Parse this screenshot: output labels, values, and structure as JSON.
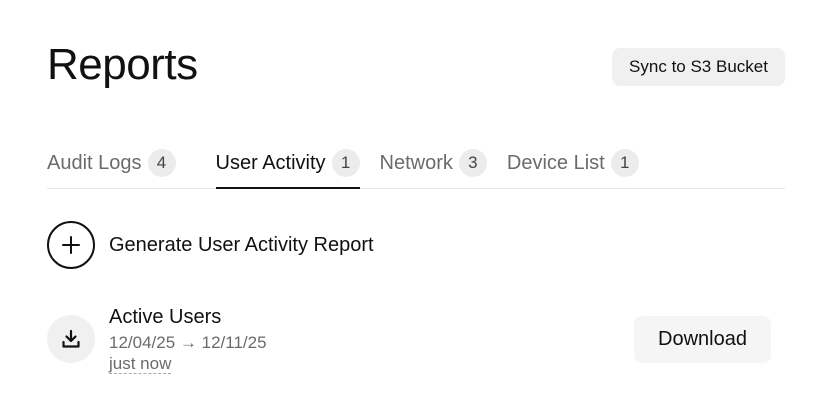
{
  "header": {
    "title": "Reports",
    "sync_button_label": "Sync to S3 Bucket"
  },
  "tabs": [
    {
      "label": "Audit Logs",
      "count": "4",
      "active": false
    },
    {
      "label": "User Activity",
      "count": "1",
      "active": true
    },
    {
      "label": "Network",
      "count": "3",
      "active": false
    },
    {
      "label": "Device List",
      "count": "1",
      "active": false
    }
  ],
  "generate": {
    "icon": "plus-icon",
    "label": "Generate User Activity Report"
  },
  "reports": [
    {
      "icon": "download-icon",
      "name": "Active Users",
      "range": "12/04/25 → 12/11/25",
      "time": "just now",
      "download_label": "Download"
    }
  ]
}
